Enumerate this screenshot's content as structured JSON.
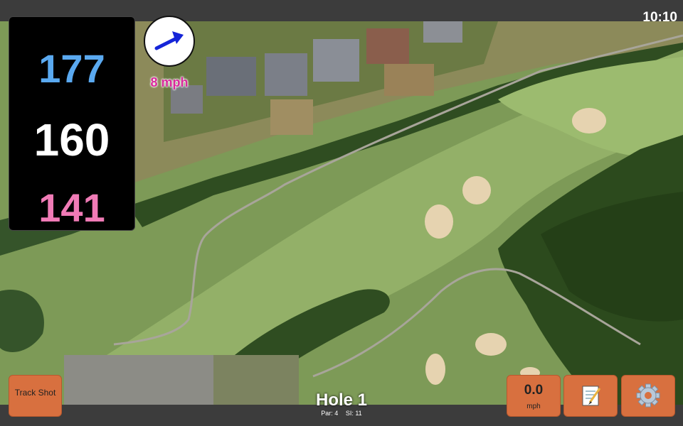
{
  "clock": "10:10",
  "distances": {
    "back": "177",
    "middle": "160",
    "front": "141"
  },
  "wind": {
    "speed_label": "8 mph"
  },
  "track_shot": {
    "label": "Track Shot"
  },
  "speed": {
    "value": "0.0",
    "unit": "mph"
  },
  "hole": {
    "title": "Hole 1",
    "par": "Par: 4",
    "stroke_index": "SI: 11"
  },
  "icons": {
    "wind_direction": "arrow-right-icon",
    "notes": "notepad-icon",
    "settings": "gear-icon"
  },
  "colors": {
    "back_distance": "#5aa9f0",
    "middle_distance": "#ffffff",
    "front_distance": "#f07bb6",
    "wind_arrow": "#1525d8",
    "wind_text": "#d9299c",
    "button": "#d8703f"
  }
}
